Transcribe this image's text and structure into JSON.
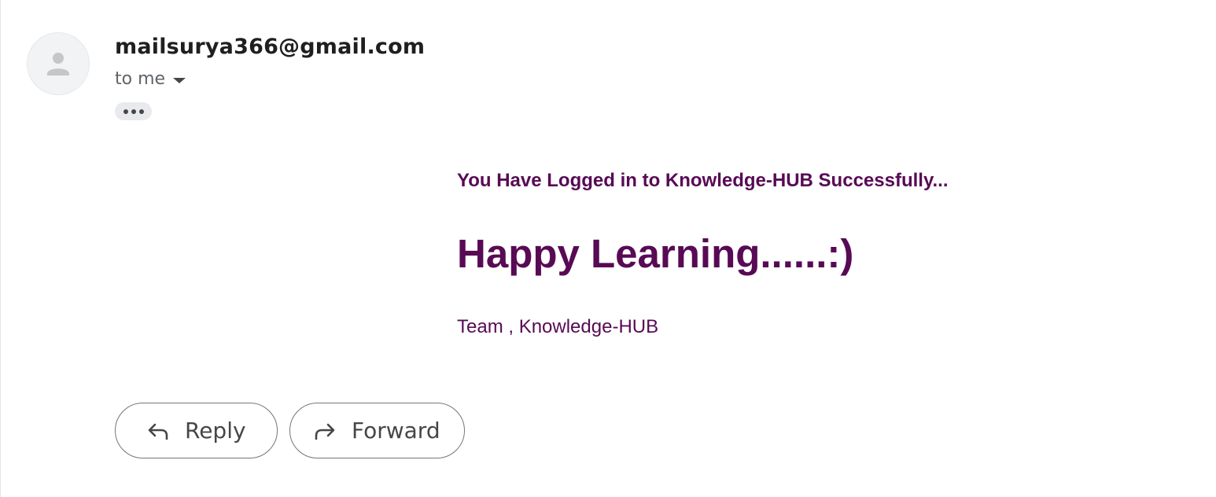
{
  "message": {
    "sender_email": "mailsurya366@gmail.com",
    "recipient_label": "to me",
    "more_icon": "more-horiz-icon"
  },
  "email_body": {
    "line1": "You Have Logged in to Knowledge-HUB Successfully...",
    "headline": "Happy Learning......:)",
    "signature": "Team , Knowledge-HUB",
    "text_color": "#580a55"
  },
  "actions": {
    "reply_label": "Reply",
    "forward_label": "Forward",
    "reply_icon": "reply-arrow-icon",
    "forward_icon": "forward-arrow-icon"
  }
}
